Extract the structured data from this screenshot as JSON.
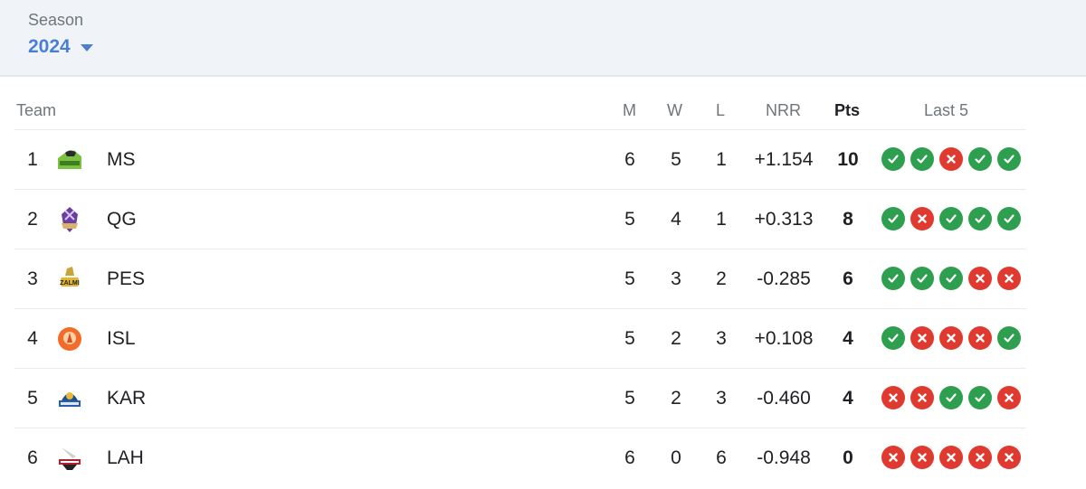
{
  "season": {
    "label": "Season",
    "selected": "2024"
  },
  "colors": {
    "accent": "#4a7fd4",
    "win": "#2e9e4f",
    "loss": "#e0392f"
  },
  "table": {
    "headers": {
      "team": "Team",
      "matches": "M",
      "won": "W",
      "lost": "L",
      "nrr": "NRR",
      "points": "Pts",
      "last5": "Last 5"
    },
    "rows": [
      {
        "rank": "1",
        "team": "MS",
        "logo": "multan-sultans-logo",
        "m": "6",
        "w": "5",
        "l": "1",
        "nrr": "+1.154",
        "pts": "10",
        "last5": [
          "W",
          "W",
          "L",
          "W",
          "W"
        ]
      },
      {
        "rank": "2",
        "team": "QG",
        "logo": "quetta-gladiators-logo",
        "m": "5",
        "w": "4",
        "l": "1",
        "nrr": "+0.313",
        "pts": "8",
        "last5": [
          "W",
          "L",
          "W",
          "W",
          "W"
        ]
      },
      {
        "rank": "3",
        "team": "PES",
        "logo": "peshawar-zalmi-logo",
        "m": "5",
        "w": "3",
        "l": "2",
        "nrr": "-0.285",
        "pts": "6",
        "last5": [
          "W",
          "W",
          "W",
          "L",
          "L"
        ]
      },
      {
        "rank": "4",
        "team": "ISL",
        "logo": "islamabad-united-logo",
        "m": "5",
        "w": "2",
        "l": "3",
        "nrr": "+0.108",
        "pts": "4",
        "last5": [
          "W",
          "L",
          "L",
          "L",
          "W"
        ]
      },
      {
        "rank": "5",
        "team": "KAR",
        "logo": "karachi-kings-logo",
        "m": "5",
        "w": "2",
        "l": "3",
        "nrr": "-0.460",
        "pts": "4",
        "last5": [
          "L",
          "L",
          "W",
          "W",
          "L"
        ]
      },
      {
        "rank": "6",
        "team": "LAH",
        "logo": "lahore-qalandars-logo",
        "m": "6",
        "w": "0",
        "l": "6",
        "nrr": "-0.948",
        "pts": "0",
        "last5": [
          "L",
          "L",
          "L",
          "L",
          "L"
        ]
      }
    ]
  }
}
